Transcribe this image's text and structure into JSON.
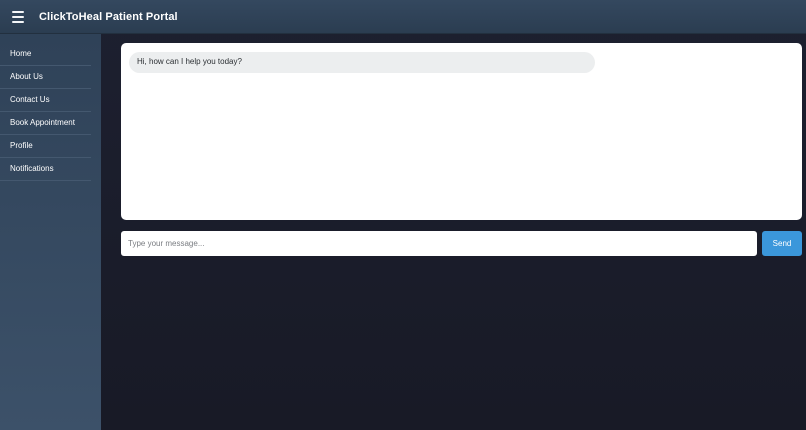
{
  "header": {
    "menu_icon": "hamburger-menu-icon",
    "title": "ClickToHeal Patient Portal"
  },
  "sidebar": {
    "items": [
      {
        "label": "Home"
      },
      {
        "label": "About Us"
      },
      {
        "label": "Contact Us"
      },
      {
        "label": "Book Appointment"
      },
      {
        "label": "Profile"
      },
      {
        "label": "Notifications"
      }
    ]
  },
  "chat": {
    "messages": [
      {
        "sender": "bot",
        "text": "Hi, how can I help you today?"
      }
    ]
  },
  "composer": {
    "placeholder": "Type your message...",
    "value": "",
    "send_label": "Send"
  },
  "colors": {
    "header_bg": "#2f4258",
    "sidebar_bg": "#34485f",
    "page_bg": "#1a1c28",
    "send_button": "#3b97db",
    "bubble_bg": "#eceeef"
  }
}
